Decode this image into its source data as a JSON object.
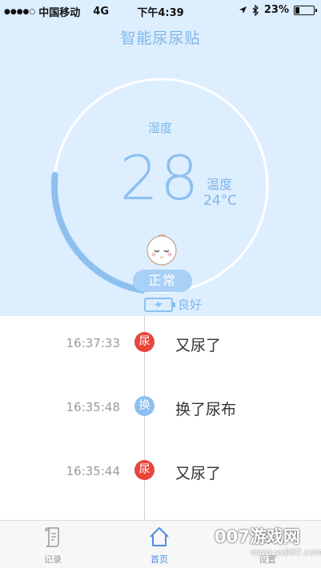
{
  "status_bar": {
    "signal": "●●●●○",
    "carrier": "中国移动",
    "network": "4G",
    "time": "下午4:39",
    "battery_percent": "23%"
  },
  "app": {
    "title": "智能尿尿贴"
  },
  "gauge": {
    "humidity_label": "湿度",
    "humidity_value": "28",
    "humidity_fraction": 0.28,
    "temperature_label": "温度",
    "temperature_value": "24°C",
    "state_label": "正常",
    "battery_label": "良好",
    "accent_color": "#8cc0f0"
  },
  "timeline": {
    "events": [
      {
        "time": "16:37:33",
        "badge": "尿",
        "type": "pee",
        "desc": "又尿了"
      },
      {
        "time": "16:35:48",
        "badge": "换",
        "type": "change",
        "desc": "换了尿布"
      },
      {
        "time": "16:35:44",
        "badge": "尿",
        "type": "pee",
        "desc": "又尿了"
      }
    ]
  },
  "tabbar": {
    "records_label": "记录",
    "home_label": "首页",
    "settings_label": "设置",
    "active_color": "#4a90e2"
  },
  "watermark": {
    "text": "007游戏网",
    "url": "www.yx007.com"
  }
}
